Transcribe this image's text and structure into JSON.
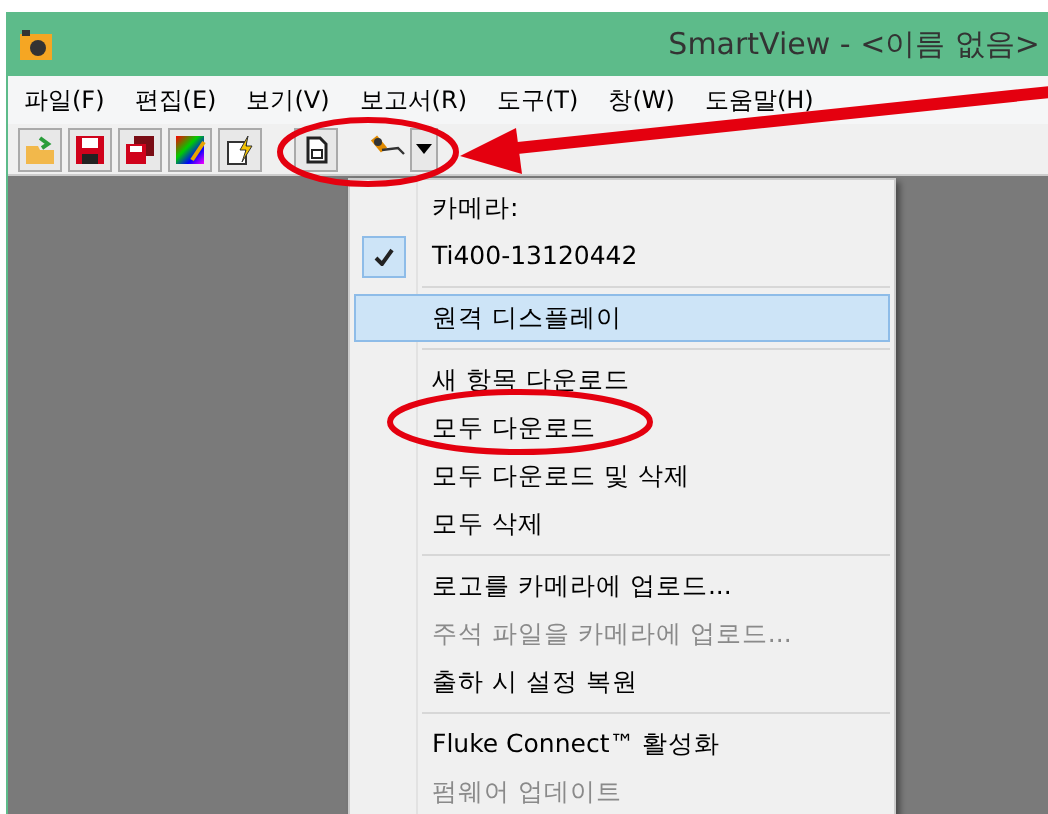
{
  "window": {
    "title": "SmartView - <이름 없음>"
  },
  "menubar": [
    "파일(F)",
    "편집(E)",
    "보기(V)",
    "보고서(R)",
    "도구(T)",
    "창(W)",
    "도움말(H)"
  ],
  "dropdown_menu": [
    {
      "kind": "header",
      "label": "카메라:"
    },
    {
      "kind": "item",
      "label": "Ti400-13120442",
      "checked": true,
      "selected": false,
      "disabled": false
    },
    {
      "kind": "separator"
    },
    {
      "kind": "item",
      "label": "원격 디스플레이",
      "checked": false,
      "selected": true,
      "disabled": false
    },
    {
      "kind": "separator"
    },
    {
      "kind": "item",
      "label": "새 항목 다운로드",
      "checked": false,
      "selected": false,
      "disabled": false
    },
    {
      "kind": "item",
      "label": "모두 다운로드",
      "checked": false,
      "selected": false,
      "disabled": false
    },
    {
      "kind": "item",
      "label": "모두 다운로드 및 삭제",
      "checked": false,
      "selected": false,
      "disabled": false
    },
    {
      "kind": "item",
      "label": "모두 삭제",
      "checked": false,
      "selected": false,
      "disabled": false
    },
    {
      "kind": "separator"
    },
    {
      "kind": "item",
      "label": "로고를 카메라에 업로드...",
      "checked": false,
      "selected": false,
      "disabled": false
    },
    {
      "kind": "item",
      "label": "주석 파일을 카메라에 업로드...",
      "checked": false,
      "selected": false,
      "disabled": true
    },
    {
      "kind": "item",
      "label": "출하 시 설정 복원",
      "checked": false,
      "selected": false,
      "disabled": false
    },
    {
      "kind": "separator"
    },
    {
      "kind": "item",
      "label": "Fluke Connect™ 활성화",
      "checked": false,
      "selected": false,
      "disabled": false
    },
    {
      "kind": "item",
      "label": "펌웨어 업데이트",
      "checked": false,
      "selected": false,
      "disabled": true
    }
  ]
}
